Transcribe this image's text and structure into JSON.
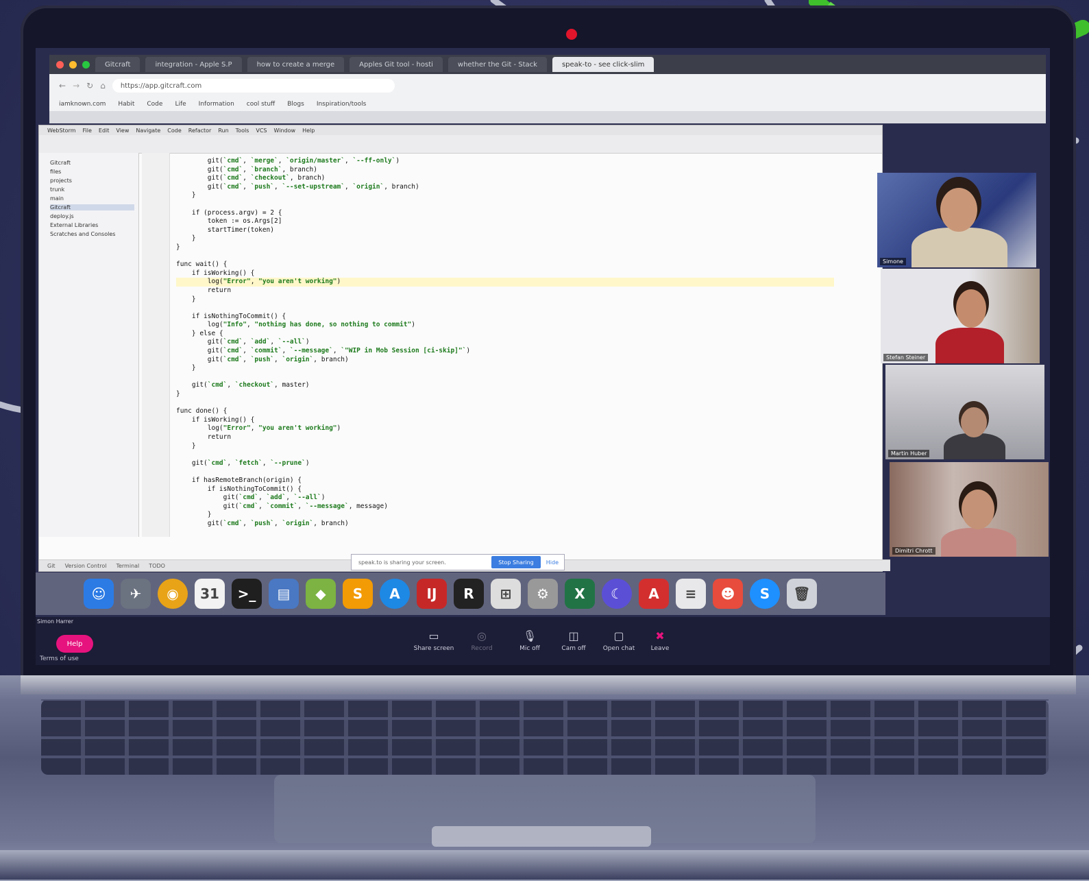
{
  "browser": {
    "tabs": [
      {
        "label": "Gitcraft"
      },
      {
        "label": "integration - Apple S.P"
      },
      {
        "label": "how to create a merge"
      },
      {
        "label": "Apples Git tool - hosti"
      },
      {
        "label": "whether the Git - Stack"
      },
      {
        "label": "speak-to - see click-slim"
      }
    ],
    "url": "https://app.gitcraft.com",
    "bookmarks": [
      "iamknown.com",
      "Habit",
      "Code",
      "Life",
      "Information",
      "cool stuff",
      "Blogs",
      "Inspiration/tools"
    ]
  },
  "ide": {
    "menus": [
      "WebStorm",
      "File",
      "Edit",
      "View",
      "Navigate",
      "Code",
      "Refactor",
      "Run",
      "Tools",
      "VCS",
      "Window",
      "Help"
    ],
    "tree": [
      "Gitcraft",
      "files",
      "projects",
      "trunk",
      "main",
      "Gitcraft",
      "deploy.js",
      "External Libraries",
      "Scratches and Consoles"
    ],
    "code_lines": [
      "        git(`cmd`, `merge`, `origin/master`, `--ff-only`)",
      "        git(`cmd`, `branch`, branch)",
      "        git(`cmd`, `checkout`, branch)",
      "        git(`cmd`, `push`, `--set-upstream`, `origin`, branch)",
      "    }",
      "",
      "    if (process.argv) = 2 {",
      "        token := os.Args[2]",
      "        startTimer(token)",
      "    }",
      "}",
      "",
      "func wait() {",
      "    if isWorking() {",
      "        log(\"Error\", \"you aren't working\")",
      "        return",
      "    }",
      "",
      "    if isNothingToCommit() {",
      "        log(\"Info\", \"nothing has done, so nothing to commit\")",
      "    } else {",
      "        git(`cmd`, `add`, `--all`)",
      "        git(`cmd`, `commit`, `--message`, `\"WIP in Mob Session [ci-skip]\"`)",
      "        git(`cmd`, `push`, `origin`, branch)",
      "    }",
      "",
      "    git(`cmd`, `checkout`, master)",
      "}",
      "",
      "func done() {",
      "    if isWorking() {",
      "        log(\"Error\", \"you aren't working\")",
      "        return",
      "    }",
      "",
      "    git(`cmd`, `fetch`, `--prune`)",
      "",
      "    if hasRemoteBranch(origin) {",
      "        if isNothingToCommit() {",
      "            git(`cmd`, `add`, `--all`)",
      "            git(`cmd`, `commit`, `--message`, message)",
      "        }",
      "        git(`cmd`, `push`, `origin`, branch)"
    ],
    "status": [
      "Git",
      "Version Control",
      "Terminal",
      "TODO"
    ]
  },
  "sharing_notice": {
    "text": "speak.to is sharing your screen.",
    "stop_label": "Stop Sharing",
    "hide_label": "Hide"
  },
  "participants": [
    {
      "name": "Simone"
    },
    {
      "name": "Stefan Steiner"
    },
    {
      "name": "Martin Huber"
    },
    {
      "name": "Dimitri Chrott"
    }
  ],
  "self_name": "Simon Harrer",
  "dock_icons": [
    "finder-icon",
    "launchpad-icon",
    "chrome-icon",
    "calendar-icon",
    "terminal-icon",
    "preview-icon",
    "android-studio-icon",
    "sublime-icon",
    "app-store-icon",
    "intellij-icon",
    "rider-icon",
    "screenshot-icon",
    "settings-icon",
    "excel-icon",
    "moon-icon",
    "acrobat-icon",
    "notes-icon",
    "mascot-icon",
    "skype-icon",
    "trash-icon"
  ],
  "zoom_controls": [
    {
      "label": "Share screen",
      "icon": "screen-icon"
    },
    {
      "label": "Record",
      "icon": "record-icon"
    },
    {
      "label": "Mic off",
      "icon": "mic-icon"
    },
    {
      "label": "Cam off",
      "icon": "camera-icon"
    },
    {
      "label": "Open chat",
      "icon": "chat-icon"
    },
    {
      "label": "Leave",
      "icon": "leave-icon"
    }
  ],
  "help_label": "Help",
  "terms_label": "Terms of use",
  "colors": {
    "background": "#2c2f58",
    "accent_green": "#3fbf2c",
    "help_pink": "#e6137e",
    "camera_led": "#e0142b"
  }
}
